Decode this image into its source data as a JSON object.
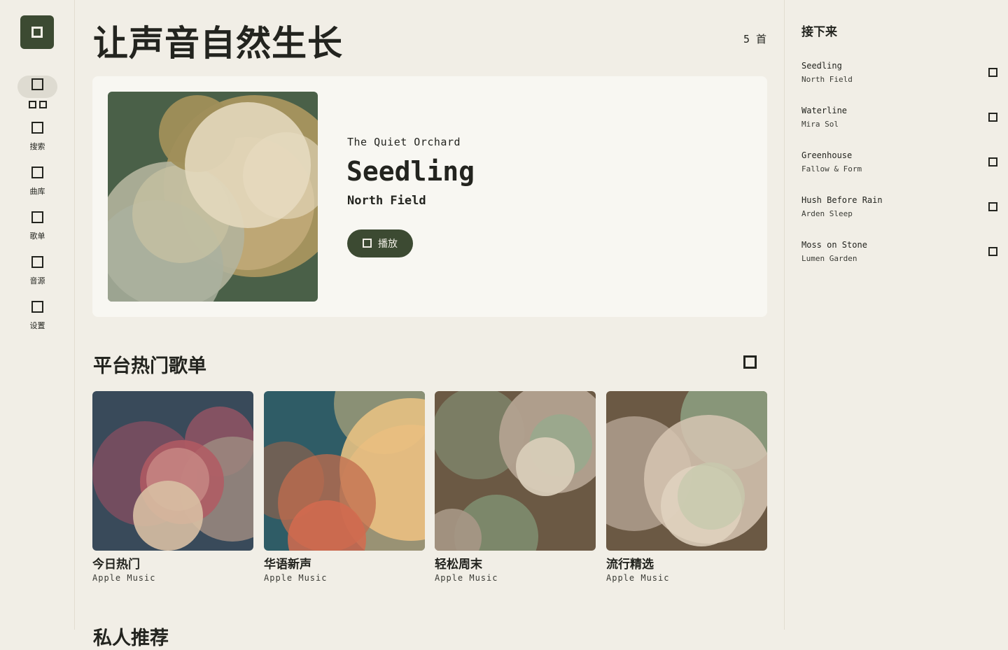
{
  "rail": {
    "items": [
      {
        "name": "home",
        "label": ""
      },
      {
        "name": "search",
        "label": "搜索"
      },
      {
        "name": "library",
        "label": "曲库"
      },
      {
        "name": "playlists",
        "label": "歌单"
      },
      {
        "name": "sources",
        "label": "音源"
      },
      {
        "name": "settings",
        "label": "设置"
      }
    ]
  },
  "header": {
    "title": "让声音自然生长",
    "count": "5 首"
  },
  "hero": {
    "album": "The Quiet Orchard",
    "title": "Seedling",
    "artist": "North Field",
    "play_label": "播放"
  },
  "playlists": {
    "title": "平台热门歌单",
    "items": [
      {
        "name": "今日热门",
        "source": "Apple Music"
      },
      {
        "name": "华语新声",
        "source": "Apple Music"
      },
      {
        "name": "轻松周末",
        "source": "Apple Music"
      },
      {
        "name": "流行精选",
        "source": "Apple Music"
      }
    ]
  },
  "next_section": {
    "title": "私人推荐"
  },
  "queue": {
    "title": "接下来",
    "items": [
      {
        "song": "Seedling",
        "artist": "North Field"
      },
      {
        "song": "Waterline",
        "artist": "Mira Sol"
      },
      {
        "song": "Greenhouse",
        "artist": "Fallow & Form"
      },
      {
        "song": "Hush Before Rain",
        "artist": "Arden Sleep"
      },
      {
        "song": "Moss on Stone",
        "artist": "Lumen Garden"
      }
    ]
  },
  "colors": {
    "background": "#f1eee6",
    "accent": "#3c4a32",
    "card": "#f8f7f2",
    "text": "#23241f"
  },
  "icons": {
    "logo": "app-logo-icon",
    "rail": [
      "home-icon",
      "grid-icon",
      "search-icon",
      "library-icon",
      "playlist-icon",
      "source-icon",
      "settings-icon"
    ],
    "play": "play-icon",
    "more": "more-icon",
    "queue_action": "queue-action-icon"
  }
}
